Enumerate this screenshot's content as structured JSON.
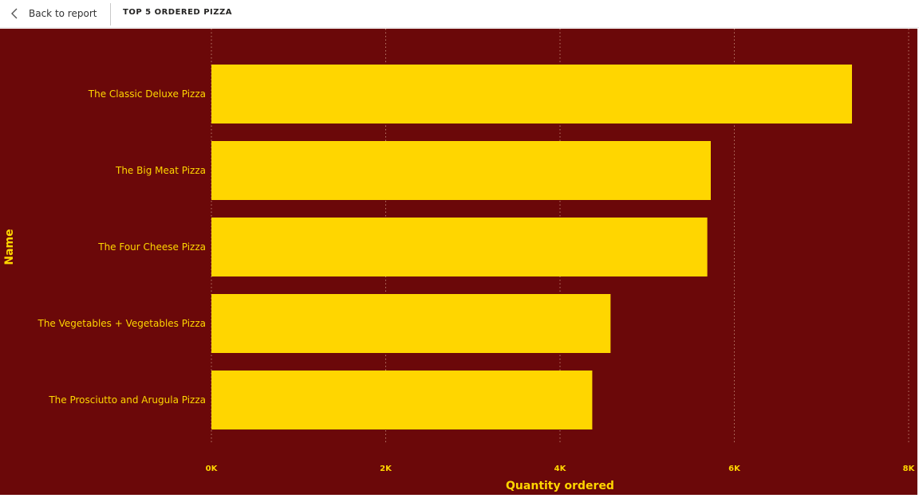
{
  "header": {
    "back_label": "Back to report",
    "title": "TOP 5 ORDERED PIZZA"
  },
  "icons": {
    "back": "chevron-left-icon"
  },
  "colors": {
    "background": "#6b0809",
    "bar": "#ffd600",
    "text": "#ffd600",
    "grid": "#b87a6a"
  },
  "chart_data": {
    "type": "bar",
    "orientation": "horizontal",
    "title": "",
    "xlabel": "Quantity ordered",
    "ylabel": "Name",
    "categories": [
      "The Classic Deluxe Pizza",
      "The Big Meat Pizza",
      "The Four Cheese Pizza",
      "The Vegetables + Vegetables Pizza",
      "The Prosciutto and Arugula Pizza"
    ],
    "values": [
      7350,
      5730,
      5690,
      4580,
      4370
    ],
    "xlim": [
      0,
      8000
    ],
    "xticks": [
      "0K",
      "2K",
      "4K",
      "6K",
      "8K"
    ],
    "grid": true
  }
}
